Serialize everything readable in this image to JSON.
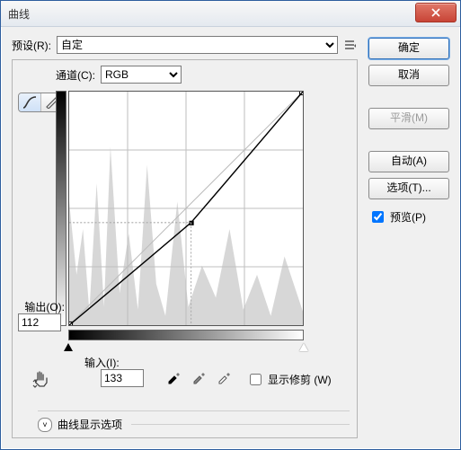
{
  "window": {
    "title": "曲线"
  },
  "preset": {
    "label": "预设(R):",
    "value": "自定",
    "options": [
      "自定"
    ]
  },
  "channel": {
    "label": "通道(C):",
    "value": "RGB",
    "options": [
      "RGB"
    ]
  },
  "output": {
    "label": "输出(O):",
    "value": "112"
  },
  "input": {
    "label": "输入(I):",
    "value": "133"
  },
  "clipping": {
    "label": "显示修剪 (W)",
    "checked": false
  },
  "display_options": {
    "label": "曲线显示选项"
  },
  "buttons": {
    "ok": "确定",
    "cancel": "取消",
    "smooth": "平滑(M)",
    "auto": "自动(A)",
    "options": "选项(T)..."
  },
  "preview": {
    "label": "预览(P)",
    "checked": true
  },
  "icons": {
    "close": "close-icon",
    "menu": "preset-menu-icon",
    "curve_tool": "curve-tool-icon",
    "pencil_tool": "pencil-tool-icon",
    "hand": "target-adjust-icon",
    "eyedropper_black": "eyedropper-black-icon",
    "eyedropper_gray": "eyedropper-gray-icon",
    "eyedropper_white": "eyedropper-white-icon",
    "expand": "expand-icon"
  },
  "chart_data": {
    "type": "line",
    "title": "",
    "xlabel": "输入",
    "ylabel": "输出",
    "xlim": [
      0,
      255
    ],
    "ylim": [
      0,
      255
    ],
    "grid": true,
    "series": [
      {
        "name": "curve",
        "x": [
          0,
          133,
          255
        ],
        "y": [
          0,
          112,
          255
        ]
      },
      {
        "name": "baseline",
        "x": [
          0,
          255
        ],
        "y": [
          0,
          255
        ]
      }
    ],
    "selected_point": {
      "x": 133,
      "y": 112
    }
  }
}
